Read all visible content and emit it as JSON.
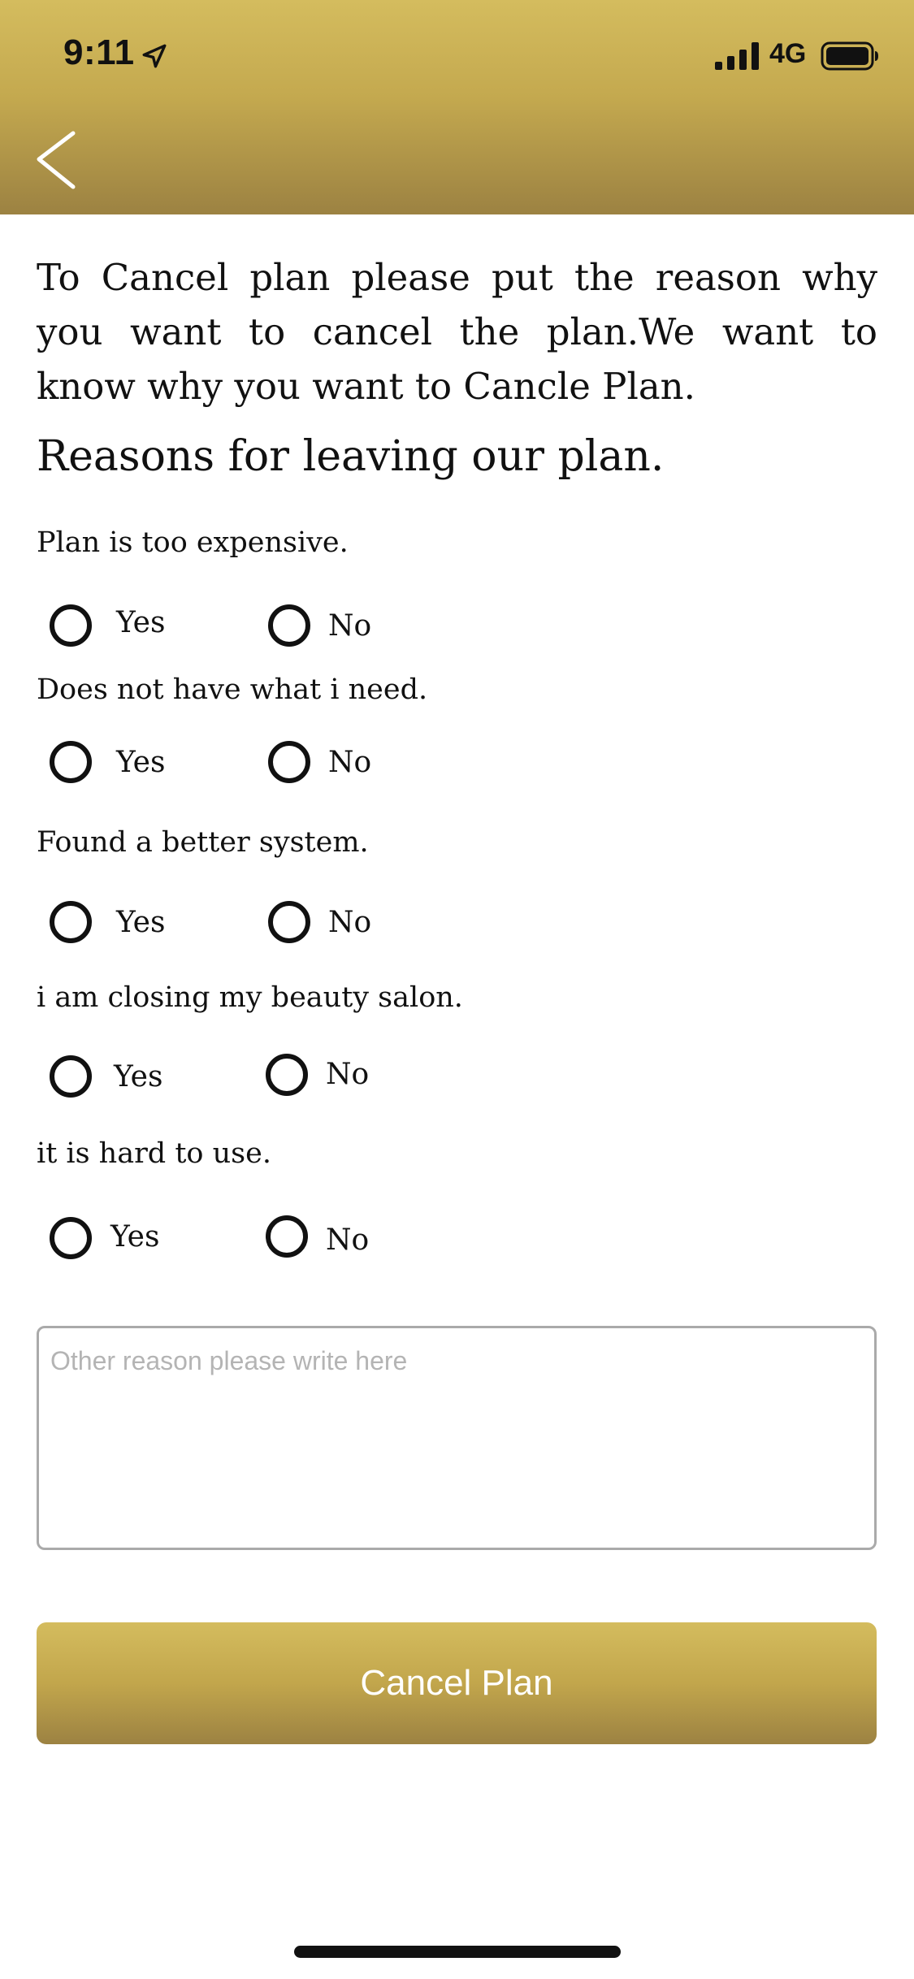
{
  "status_bar": {
    "time": "9:11",
    "network": "4G",
    "icons": [
      "location-arrow-icon",
      "signal-icon",
      "battery-icon"
    ]
  },
  "header": {
    "back_icon": "chevron-left-icon"
  },
  "intro_text": "To Cancel plan please put the  reason why you want to cancel the plan.We want to know why you want to Cancle Plan.",
  "section_title": "Reasons for leaving our plan.",
  "questions": [
    {
      "text": "Plan is too expensive.",
      "yes_label": "Yes",
      "no_label": "No"
    },
    {
      "text": "Does not have what i need.",
      "yes_label": "Yes",
      "no_label": "No"
    },
    {
      "text": "Found a better system.",
      "yes_label": "Yes",
      "no_label": "No"
    },
    {
      "text": "i am closing  my beauty salon.",
      "yes_label": "Yes",
      "no_label": "No"
    },
    {
      "text": "it is hard to use.",
      "yes_label": "Yes",
      "no_label": "No"
    }
  ],
  "other_reason": {
    "value": "",
    "placeholder": "Other reason please write here"
  },
  "cancel_button": {
    "label": "Cancel Plan"
  },
  "colors": {
    "gold_light": "#d4bc5e",
    "gold_dark": "#9c8242",
    "text": "#111111",
    "placeholder": "#b4b4b4"
  }
}
